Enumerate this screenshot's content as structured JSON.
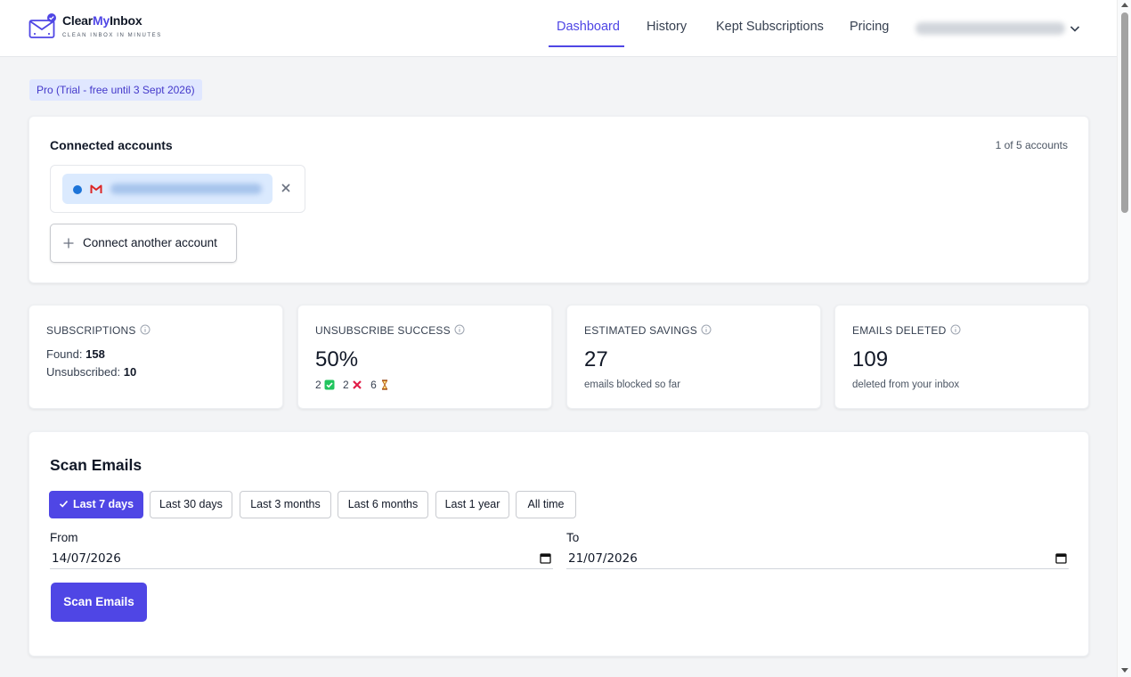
{
  "brand": {
    "name_prefix": "Clear",
    "name_accent": "My",
    "name_suffix": "Inbox",
    "tagline": "CLEAN INBOX IN MINUTES",
    "accent_color": "#4f46e5"
  },
  "nav": {
    "items": [
      {
        "label": "Dashboard",
        "active": true
      },
      {
        "label": "History",
        "active": false
      },
      {
        "label": "Kept Subscriptions",
        "active": false
      },
      {
        "label": "Pricing",
        "active": false
      }
    ],
    "account_menu_icon": "chevron-down-icon"
  },
  "plan": {
    "badge": "Pro (Trial - free until 3 Sept 2026)"
  },
  "connected_accounts": {
    "title": "Connected accounts",
    "count": "1 of 5 accounts",
    "provider_icon": "gmail-icon",
    "remove_icon": "close-icon",
    "connect_button": "Connect another account"
  },
  "stats": {
    "subscriptions": {
      "label": "SUBSCRIPTIONS",
      "found_label": "Found:",
      "found": "158",
      "unsubscribed_label": "Unsubscribed:",
      "unsubscribed": "10"
    },
    "unsubscribe_success": {
      "label": "UNSUBSCRIBE SUCCESS",
      "value": "50%",
      "succeeded": "2",
      "failed": "2",
      "pending": "6"
    },
    "estimated_savings": {
      "label": "ESTIMATED SAVINGS",
      "value": "27",
      "sub": "emails blocked so far"
    },
    "emails_deleted": {
      "label": "EMAILS DELETED",
      "value": "109",
      "sub": "deleted from your inbox"
    }
  },
  "scan": {
    "title": "Scan Emails",
    "ranges": [
      {
        "label": "Last 7 days",
        "active": true
      },
      {
        "label": "Last 30 days",
        "active": false
      },
      {
        "label": "Last 3 months",
        "active": false
      },
      {
        "label": "Last 6 months",
        "active": false
      },
      {
        "label": "Last 1 year",
        "active": false
      },
      {
        "label": "All time",
        "active": false
      }
    ],
    "from_label": "From",
    "from_value": "14/07/2026",
    "to_label": "To",
    "to_value": "21/07/2026",
    "button": "Scan Emails"
  }
}
